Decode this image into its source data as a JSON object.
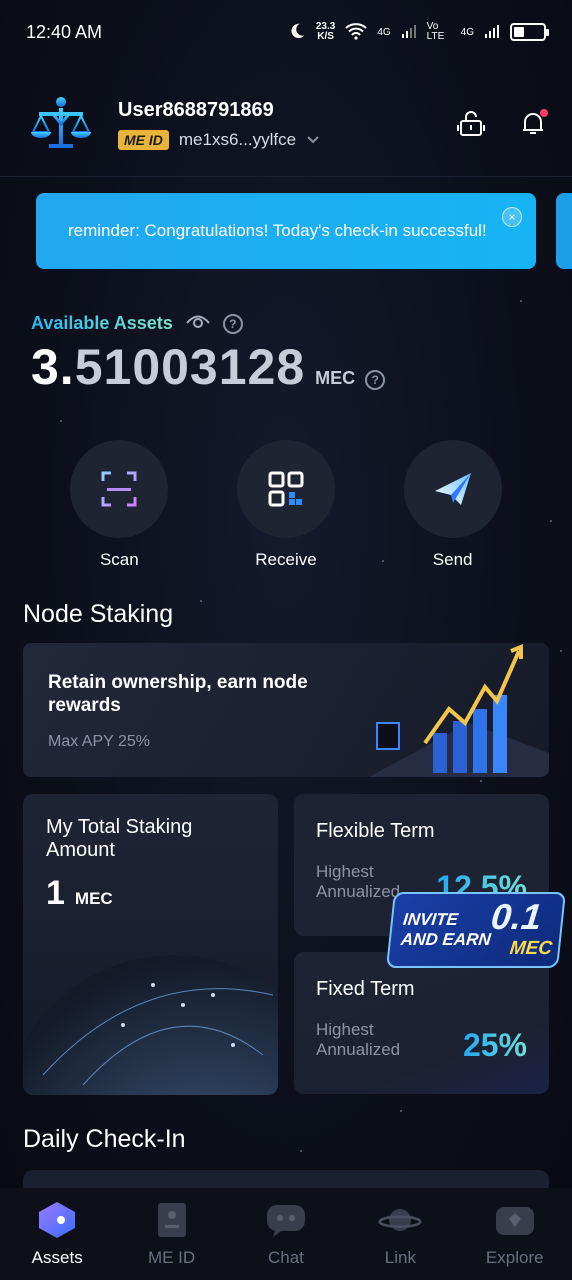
{
  "status_bar": {
    "time": "12:40 AM",
    "net_speed": "23.3",
    "net_unit": "K/S",
    "net1": "4G",
    "volte": "Vo LTE",
    "net2": "4G"
  },
  "header": {
    "username": "User8688791869",
    "me_id_badge": "ME ID",
    "me_id_value": "me1xs6...yylfce"
  },
  "banner": {
    "text": "reminder: Congratulations! Today's check-in successful!",
    "close": "×"
  },
  "assets": {
    "label": "Available Assets",
    "balance_first": "3.",
    "balance_rest": "51003128",
    "unit": "MEC",
    "help": "?"
  },
  "actions": [
    {
      "label": "Scan"
    },
    {
      "label": "Receive"
    },
    {
      "label": "Send"
    }
  ],
  "node_staking": {
    "title": "Node Staking",
    "card_title": "Retain ownership, earn node rewards",
    "card_sub": "Max APY 25%"
  },
  "total_staking": {
    "title": "My Total Staking Amount",
    "amount": "1",
    "unit": "MEC"
  },
  "flexible": {
    "title": "Flexible Term",
    "label": "Highest Annualized",
    "value": "12.5%"
  },
  "fixed": {
    "title": "Fixed Term",
    "label": "Highest Annualized",
    "value": "25%"
  },
  "invite": {
    "line1": "INVITE",
    "line2": "AND EARN",
    "amount": "0.1",
    "unit": "MEC"
  },
  "daily_checkin": {
    "title": "Daily Check-In"
  },
  "nav": [
    {
      "label": "Assets",
      "icon": "assets-icon",
      "active": true
    },
    {
      "label": "ME ID",
      "icon": "id-card-icon",
      "active": false
    },
    {
      "label": "Chat",
      "icon": "chat-icon",
      "active": false
    },
    {
      "label": "Link",
      "icon": "planet-icon",
      "active": false
    },
    {
      "label": "Explore",
      "icon": "explore-icon",
      "active": false
    }
  ],
  "colors": {
    "accent_blue": "#22a7f0",
    "meid_badge": "#e8b53a",
    "background": "#0c0f1a"
  }
}
